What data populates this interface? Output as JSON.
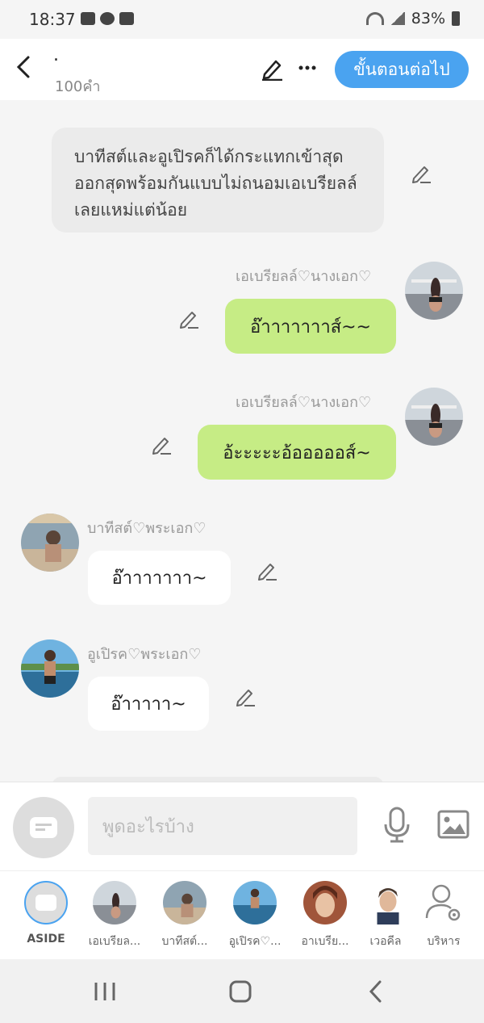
{
  "status_bar": {
    "time": "18:37",
    "battery": "83%"
  },
  "header": {
    "title": ".",
    "word_count": "100คำ",
    "next_label": "ขั้นตอนต่อไป"
  },
  "chat": {
    "narration": "บาทีสต์และอูเปิรคก็ได้กระแทกเข้าสุดออกสุดพร้อมกันแบบไม่ถนอมเอเบรียลล์เลยแหม่แต่น้อย",
    "messages": [
      {
        "name": "เอเบรียลล์♡นางเอก♡",
        "text": "อ๊าาาาาาาส์~~"
      },
      {
        "name": "เอเบรียลล์♡นางเอก♡",
        "text": "อ้ะะะะะอ้อออออส์~"
      },
      {
        "name": "บาทีสต์♡พระเอก♡",
        "text": "อ๊าาาาาาา~"
      },
      {
        "name": "อูเปิรค♡พระเอก♡",
        "text": "อ๊าาาาา~"
      }
    ]
  },
  "input": {
    "placeholder": "พูดอะไรบ้าง"
  },
  "characters": [
    {
      "label": "ASIDE"
    },
    {
      "label": "เอเบรียล..."
    },
    {
      "label": "บาทีสต์..."
    },
    {
      "label": "อูเปิรค♡..."
    },
    {
      "label": "อาเบรีย..."
    },
    {
      "label": "เวอคีล"
    },
    {
      "label": "บริหาร"
    }
  ],
  "colors": {
    "accent": "#4aa3f0",
    "bubble_green": "#c6ec85",
    "bubble_white": "#ffffff",
    "narration_bg": "#ebebeb"
  }
}
